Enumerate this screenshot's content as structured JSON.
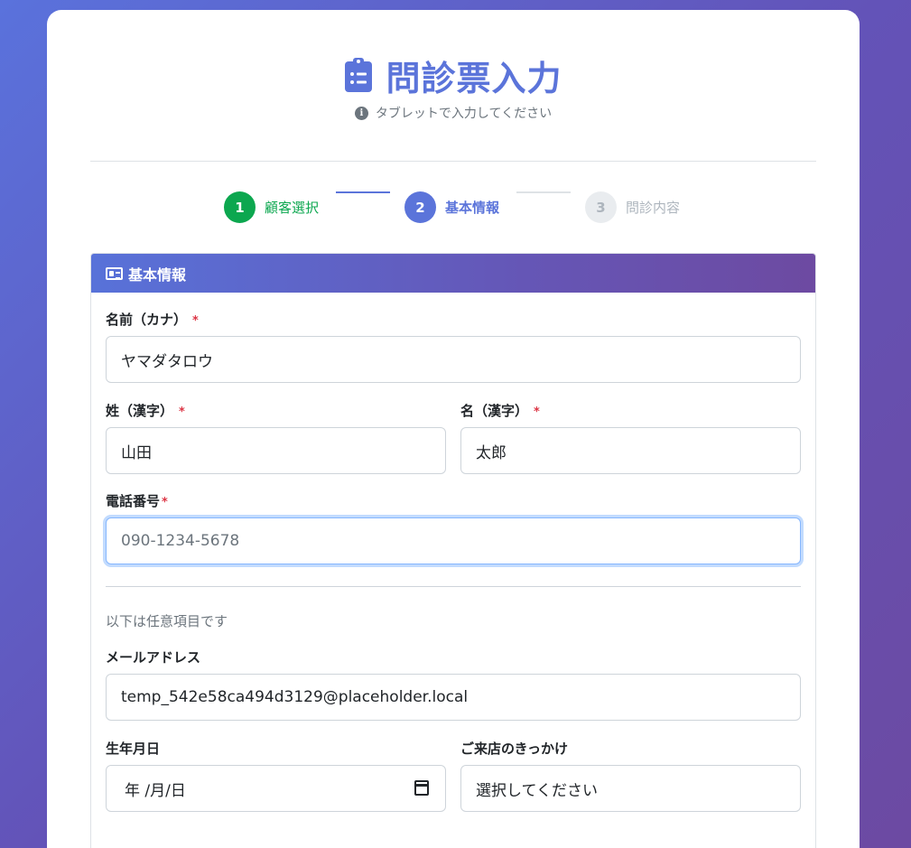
{
  "header": {
    "title": "問診票入力",
    "subtitle": "タブレットで入力してください",
    "title_icon": "clipboard-list-icon",
    "subtitle_icon": "info-circle-icon"
  },
  "steps": [
    {
      "number": "1",
      "label": "顧客選択",
      "state": "completed"
    },
    {
      "number": "2",
      "label": "基本情報",
      "state": "active"
    },
    {
      "number": "3",
      "label": "問診内容",
      "state": "pending"
    }
  ],
  "panel": {
    "title": "基本情報",
    "icon": "id-card-icon"
  },
  "form": {
    "kana_label": "名前（カナ）",
    "kana_value": "ヤマダタロウ",
    "last_label": "姓（漢字）",
    "last_value": "山田",
    "first_label": "名（漢字）",
    "first_value": "太郎",
    "phone_label": "電話番号",
    "phone_placeholder": "090-1234-5678",
    "required_mark": "*",
    "optional_note": "以下は任意項目です",
    "email_label": "メールアドレス",
    "email_value": "temp_542e58ca494d3129@placeholder.local",
    "birth_label": "生年月日",
    "birth_placeholder": "年 /月/日",
    "visit_label": "ご来店のきっかけ",
    "visit_selected": "選択してください"
  },
  "colors": {
    "primary": "#5b74da",
    "success": "#0ca74f",
    "required": "#dc3545",
    "muted": "#6c757d"
  }
}
